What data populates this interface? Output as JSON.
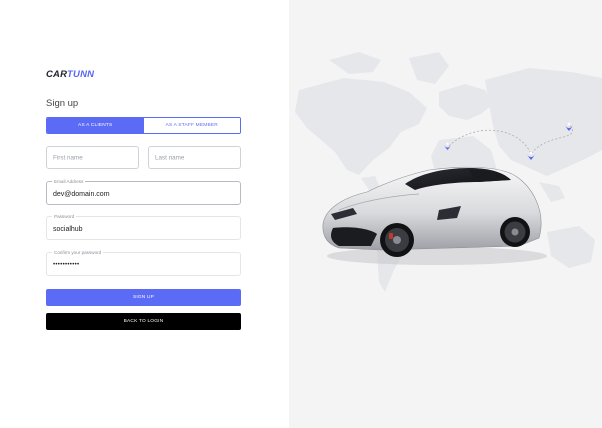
{
  "brand": {
    "part1": "CAR",
    "part2": "TUNN"
  },
  "title": "Sign up",
  "role_toggle": {
    "option1": "AS A CLIENTS",
    "option2": "AS A STAFF MEMBER",
    "selected": "AS A CLIENTS"
  },
  "fields": {
    "first_name": {
      "placeholder": "First name"
    },
    "last_name": {
      "placeholder": "Last name"
    },
    "email": {
      "label": "Email Address",
      "value": "dev@domain.com"
    },
    "password": {
      "label": "Password",
      "value": "socialhub"
    },
    "confirm_password": {
      "label": "Confirm your password",
      "value": "•••••••••••"
    }
  },
  "buttons": {
    "sign_up": "SIGN UP",
    "back_to_login": "BACK TO LOGIN"
  },
  "colors": {
    "accent": "#5b6bf5",
    "brand_dark": "#23232f",
    "brand_accent": "#5865f2",
    "panel_bg": "#f4f4f5"
  },
  "icons": {
    "map_pin": "map-pin-icon"
  }
}
